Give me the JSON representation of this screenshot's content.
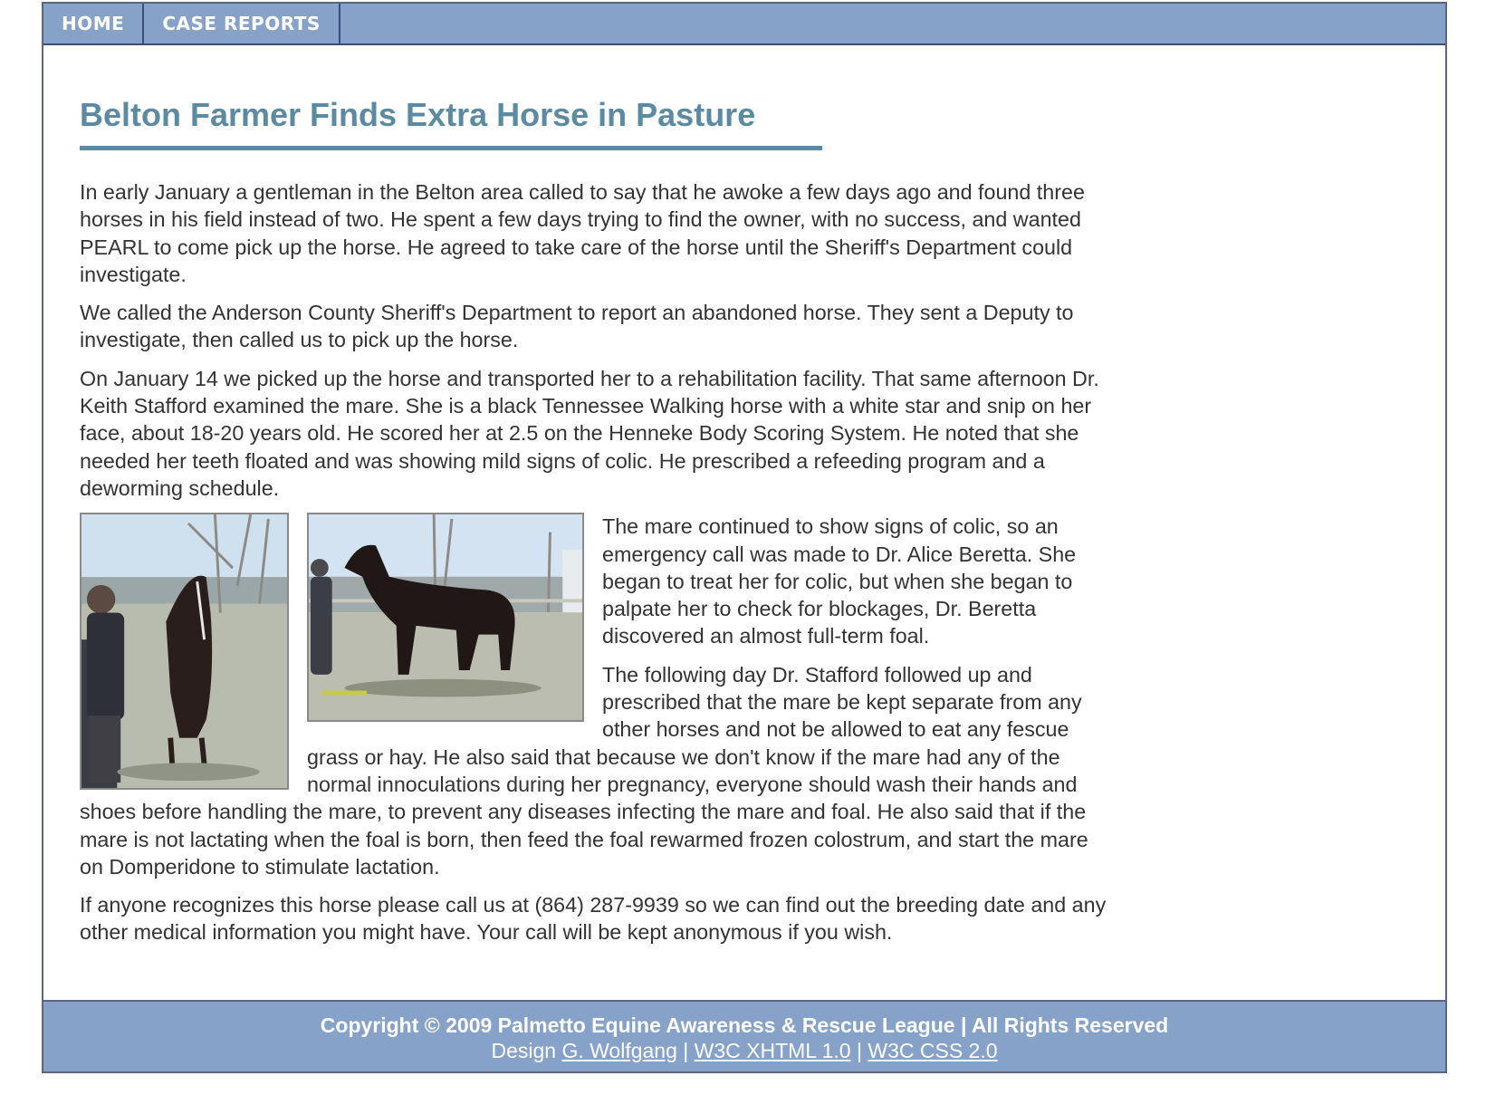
{
  "nav": {
    "items": [
      {
        "label": "HOME"
      },
      {
        "label": "CASE REPORTS"
      }
    ]
  },
  "article": {
    "title": "Belton Farmer Finds Extra Horse in Pasture",
    "paragraphs": [
      "In early January a gentleman in the Belton area called to say that he awoke a few days ago and found three horses in his field instead of two. He spent a few days trying to find the owner, with no success, and wanted PEARL to come pick up the horse. He agreed to take care of the horse until the Sheriff's Department could investigate.",
      "We called the Anderson County Sheriff's Department to report an abandoned horse. They sent a Deputy to investigate, then called us to pick up the horse.",
      "On January 14 we picked up the horse and transported her to a rehabilitation facility. That same afternoon Dr. Keith Stafford examined the mare. She is a black Tennessee Walking horse with a white star and snip on her face, about 18-20 years old. He scored her at 2.5 on the Henneke Body Scoring System. He noted that she needed her teeth floated and was showing mild signs of colic. He prescribed a refeeding program and a deworming schedule.",
      "The mare continued to show signs of colic, so an emergency call was made to Dr. Alice Beretta. She began to treat her for colic, but when she began to palpate her to check for blockages, Dr. Beretta discovered an almost full-term foal.",
      "The following day Dr. Stafford followed up and prescribed that the mare be kept separate from any other horses and not be allowed to eat any fescue grass or hay. He also said that because we don't know if the mare had any of the normal innoculations during her pregnancy, everyone should wash their hands and shoes before handling the mare, to prevent any diseases infecting the mare and foal. He also said that if the mare is not lactating when the foal is born, then feed the foal rewarmed frozen colostrum, and start the mare on Domperidone to stimulate lactation.",
      "If anyone recognizes this horse please call us at (864) 287-9939 so we can find out the breeding date and any other medical information you might have. Your call will be kept anonymous if you wish."
    ]
  },
  "footer": {
    "copyright": "Copyright © 2009 Palmetto Equine Awareness & Rescue League | All Rights Reserved",
    "design_prefix": "Design ",
    "designer": "G. Wolfgang",
    "separator_1": " | ",
    "xhtml": "W3C XHTML 1.0",
    "separator_2": " | ",
    "css": "W3C CSS 2.0"
  }
}
